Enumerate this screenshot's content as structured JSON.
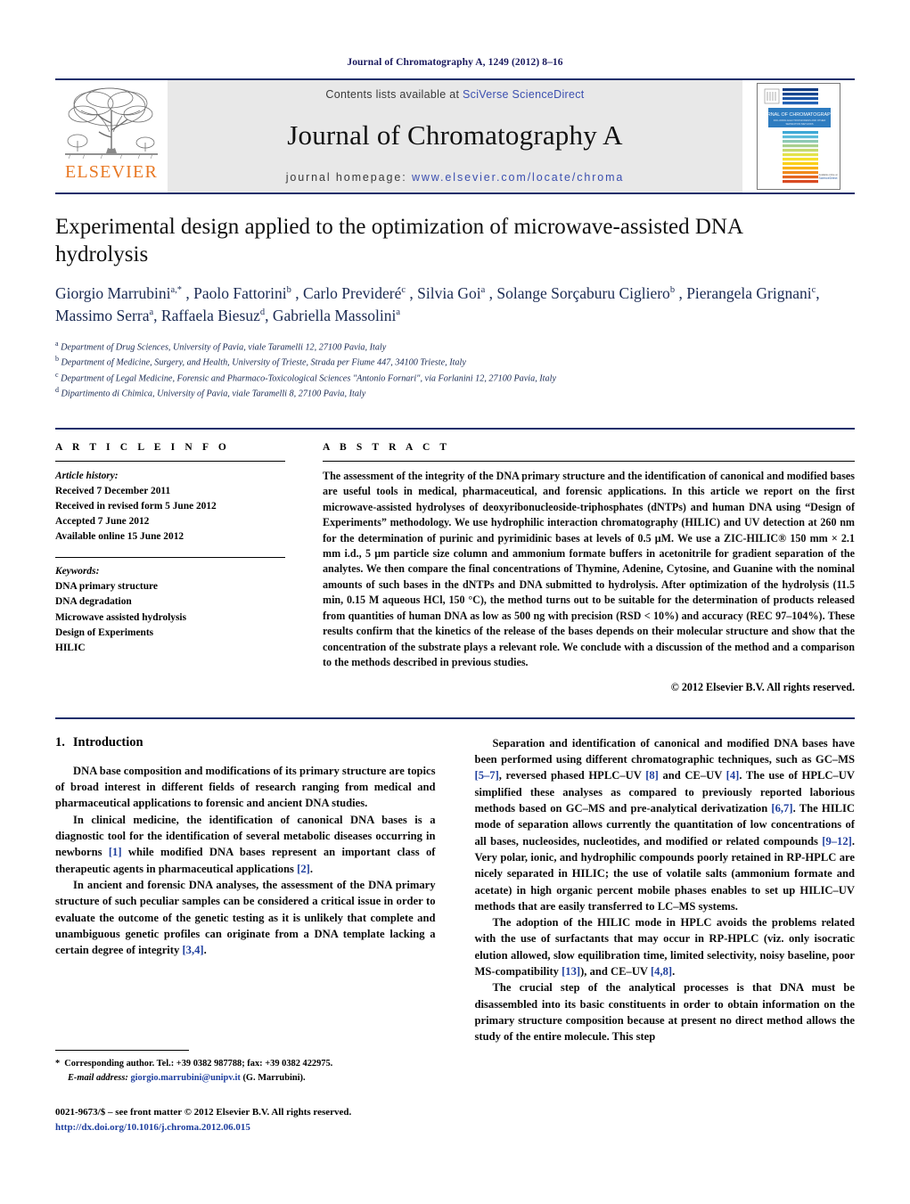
{
  "running_head": "Journal of Chromatography A, 1249 (2012) 8–16",
  "masthead": {
    "contents_prefix": "Contents lists available at ",
    "sciencedirect_link": "SciVerse ScienceDirect",
    "journal_title": "Journal of Chromatography A",
    "homepage_prefix": "journal homepage: ",
    "homepage_url": "www.elsevier.com/locate/chroma",
    "publisher_wordmark": "ELSEVIER",
    "cover_title": "JOURNAL OF CHROMATOGRAPHY A",
    "cover_subtitle": "INCLUDING ELECTROPHORESIS AND OTHER SEPARATION METHODS / SCIENCE IN THE SERVICE OF SOCIETY"
  },
  "article": {
    "title": "Experimental design applied to the optimization of microwave-assisted DNA hydrolysis",
    "authors_html": "Giorgio Marrubini<sup>a,*</sup> , Paolo Fattorini<sup>b</sup> , Carlo Previderé<sup>c</sup> , Silvia Goi<sup>a</sup> , Solange Sorçaburu Cigliero<sup>b</sup> , Pierangela Grignani<sup>c</sup>, Massimo Serra<sup>a</sup>, Raffaela Biesuz<sup>d</sup>, Gabriella Massolini<sup>a</sup>",
    "affiliations": [
      {
        "marker": "a",
        "text": "Department of Drug Sciences, University of Pavia, viale Taramelli 12, 27100 Pavia, Italy"
      },
      {
        "marker": "b",
        "text": "Department of Medicine, Surgery, and Health, University of Trieste, Strada per Fiume 447, 34100 Trieste, Italy"
      },
      {
        "marker": "c",
        "text": "Department of Legal Medicine, Forensic and Pharmaco-Toxicological Sciences \"Antonio Fornari\", via Forlanini 12, 27100 Pavia, Italy"
      },
      {
        "marker": "d",
        "text": "Dipartimento di Chimica, University of Pavia, viale Taramelli 8, 27100 Pavia, Italy"
      }
    ]
  },
  "article_info": {
    "heading": "A R T I C L E    I N F O",
    "history_label": "Article history:",
    "history": [
      "Received 7 December 2011",
      "Received in revised form 5 June 2012",
      "Accepted 7 June 2012",
      "Available online 15 June 2012"
    ],
    "keywords_label": "Keywords:",
    "keywords": [
      "DNA primary structure",
      "DNA degradation",
      "Microwave assisted hydrolysis",
      "Design of Experiments",
      "HILIC"
    ]
  },
  "abstract": {
    "heading": "A B S T R A C T",
    "text": "The assessment of the integrity of the DNA primary structure and the identification of canonical and modified bases are useful tools in medical, pharmaceutical, and forensic applications. In this article we report on the first microwave-assisted hydrolyses of deoxyribonucleoside-triphosphates (dNTPs) and human DNA using “Design of Experiments” methodology. We use hydrophilic interaction chromatography (HILIC) and UV detection at 260 nm for the determination of purinic and pyrimidinic bases at levels of 0.5 μM. We use a ZIC-HILIC® 150 mm × 2.1 mm i.d., 5 μm particle size column and ammonium formate buffers in acetonitrile for gradient separation of the analytes. We then compare the final concentrations of Thymine, Adenine, Cytosine, and Guanine with the nominal amounts of such bases in the dNTPs and DNA submitted to hydrolysis. After optimization of the hydrolysis (11.5 min, 0.15 M aqueous HCl, 150 °C), the method turns out to be suitable for the determination of products released from quantities of human DNA as low as 500 ng with precision (RSD < 10%) and accuracy (REC 97–104%). These results confirm that the kinetics of the release of the bases depends on their molecular structure and show that the concentration of the substrate plays a relevant role. We conclude with a discussion of the method and a comparison to the methods described in previous studies.",
    "copyright": "© 2012 Elsevier B.V. All rights reserved."
  },
  "body": {
    "section_number": "1.",
    "section_title": "Introduction",
    "left_paragraphs": [
      "DNA base composition and modifications of its primary structure are topics of broad interest in different fields of research ranging from medical and pharmaceutical applications to forensic and ancient DNA studies.",
      "In clinical medicine, the identification of canonical DNA bases is a diagnostic tool for the identification of several metabolic diseases occurring in newborns [1] while modified DNA bases represent an important class of therapeutic agents in pharmaceutical applications [2].",
      "In ancient and forensic DNA analyses, the assessment of the DNA primary structure of such peculiar samples can be considered a critical issue in order to evaluate the outcome of the genetic testing as it is unlikely that complete and unambiguous genetic profiles can originate from a DNA template lacking a certain degree of integrity [3,4]."
    ],
    "right_paragraphs": [
      "Separation and identification of canonical and modified DNA bases have been performed using different chromatographic techniques, such as GC–MS [5–7], reversed phased HPLC–UV [8] and CE–UV [4]. The use of HPLC–UV simplified these analyses as compared to previously reported laborious methods based on GC–MS and pre-analytical derivatization [6,7]. The HILIC mode of separation allows currently the quantitation of low concentrations of all bases, nucleosides, nucleotides, and modified or related compounds [9–12]. Very polar, ionic, and hydrophilic compounds poorly retained in RP-HPLC are nicely separated in HILIC; the use of volatile salts (ammonium formate and acetate) in high organic percent mobile phases enables to set up HILIC–UV methods that are easily transferred to LC–MS systems.",
      "The adoption of the HILIC mode in HPLC avoids the problems related with the use of surfactants that may occur in RP-HPLC (viz. only isocratic elution allowed, slow equilibration time, limited selectivity, noisy baseline, poor MS-compatibility [13]), and CE–UV [4,8].",
      "The crucial step of the analytical processes is that DNA must be disassembled into its basic constituents in order to obtain information on the primary structure composition because at present no direct method allows the study of the entire molecule. This step"
    ]
  },
  "footnotes": {
    "corresponding_star": "*",
    "corresponding_text": "Corresponding author. Tel.: +39 0382 987788; fax: +39 0382 422975.",
    "email_label": "E-mail address:",
    "email": "giorgio.marrubini@unipv.it",
    "email_attrib": "(G. Marrubini).",
    "issn_line": "0021-9673/$ – see front matter © 2012 Elsevier B.V. All rights reserved.",
    "doi_line": "http://dx.doi.org/10.1016/j.chroma.2012.06.015"
  },
  "colors": {
    "navy": "#1a2f6b",
    "link_blue": "#3b4fb0",
    "ref_blue": "#1f3f9e",
    "elsevier_orange": "#E87722",
    "banner_gray": "#e8e8e8"
  }
}
